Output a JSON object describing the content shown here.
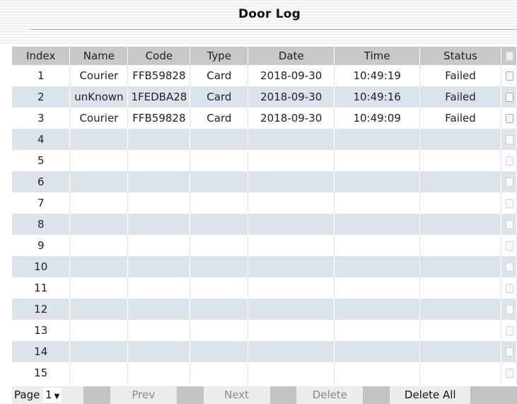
{
  "page_title": "Door Log",
  "table": {
    "columns": [
      "Index",
      "Name",
      "Code",
      "Type",
      "Date",
      "Time",
      "Status"
    ],
    "rows": [
      {
        "index": "1",
        "name": "Courier",
        "code": "FFB59828",
        "type": "Card",
        "date": "2018-09-30",
        "time": "10:49:19",
        "status": "Failed"
      },
      {
        "index": "2",
        "name": "unKnown",
        "code": "1FEDBA28",
        "type": "Card",
        "date": "2018-09-30",
        "time": "10:49:16",
        "status": "Failed"
      },
      {
        "index": "3",
        "name": "Courier",
        "code": "FFB59828",
        "type": "Card",
        "date": "2018-09-30",
        "time": "10:49:09",
        "status": "Failed"
      },
      {
        "index": "4",
        "name": "",
        "code": "",
        "type": "",
        "date": "",
        "time": "",
        "status": ""
      },
      {
        "index": "5",
        "name": "",
        "code": "",
        "type": "",
        "date": "",
        "time": "",
        "status": ""
      },
      {
        "index": "6",
        "name": "",
        "code": "",
        "type": "",
        "date": "",
        "time": "",
        "status": ""
      },
      {
        "index": "7",
        "name": "",
        "code": "",
        "type": "",
        "date": "",
        "time": "",
        "status": ""
      },
      {
        "index": "8",
        "name": "",
        "code": "",
        "type": "",
        "date": "",
        "time": "",
        "status": ""
      },
      {
        "index": "9",
        "name": "",
        "code": "",
        "type": "",
        "date": "",
        "time": "",
        "status": ""
      },
      {
        "index": "10",
        "name": "",
        "code": "",
        "type": "",
        "date": "",
        "time": "",
        "status": ""
      },
      {
        "index": "11",
        "name": "",
        "code": "",
        "type": "",
        "date": "",
        "time": "",
        "status": ""
      },
      {
        "index": "12",
        "name": "",
        "code": "",
        "type": "",
        "date": "",
        "time": "",
        "status": ""
      },
      {
        "index": "13",
        "name": "",
        "code": "",
        "type": "",
        "date": "",
        "time": "",
        "status": ""
      },
      {
        "index": "14",
        "name": "",
        "code": "",
        "type": "",
        "date": "",
        "time": "",
        "status": ""
      },
      {
        "index": "15",
        "name": "",
        "code": "",
        "type": "",
        "date": "",
        "time": "",
        "status": ""
      }
    ]
  },
  "footer": {
    "page_label": "Page",
    "page_value": "1",
    "prev_label": "Prev",
    "next_label": "Next",
    "delete_label": "Delete",
    "delete_all_label": "Delete All"
  },
  "colors": {
    "header_row": "#c8c8c8",
    "stripe_row": "#dde3ea",
    "footer_bar": "#c3c3c3",
    "title_rule": "#9fb6cf"
  }
}
